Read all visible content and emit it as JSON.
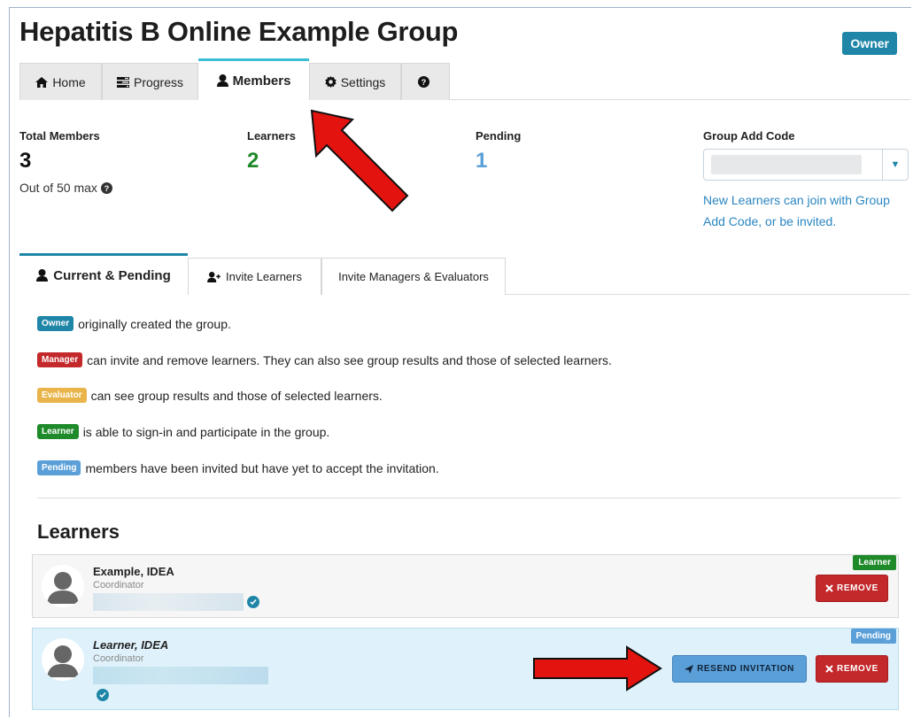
{
  "header": {
    "title": "Hepatitis B Online Example Group",
    "owner_badge": "Owner"
  },
  "tabs": [
    {
      "label": "Home",
      "icon": "home-icon"
    },
    {
      "label": "Progress",
      "icon": "progress-icon"
    },
    {
      "label": "Members",
      "icon": "user-icon",
      "active": true
    },
    {
      "label": "Settings",
      "icon": "gear-icon"
    },
    {
      "label": "",
      "icon": "help-icon"
    }
  ],
  "stats": {
    "total": {
      "label": "Total Members",
      "value": "3",
      "sub": "Out of 50 max"
    },
    "learners": {
      "label": "Learners",
      "value": "2"
    },
    "pending": {
      "label": "Pending",
      "value": "1"
    },
    "add_code": {
      "label": "Group Add Code",
      "hint": "New Learners can join with Group Add Code, or be invited."
    }
  },
  "subtabs": [
    {
      "label": "Current & Pending",
      "active": true
    },
    {
      "label": "Invite Learners"
    },
    {
      "label": "Invite Managers & Evaluators"
    }
  ],
  "roles": [
    {
      "badge": "Owner",
      "text": "originally created the group."
    },
    {
      "badge": "Manager",
      "text": "can invite and remove learners. They can also see group results and those of selected learners."
    },
    {
      "badge": "Evaluator",
      "text": "can see group results and those of selected learners."
    },
    {
      "badge": "Learner",
      "text": "is able to sign-in and participate in the group."
    },
    {
      "badge": "Pending",
      "text": "members have been invited but have yet to accept the invitation."
    }
  ],
  "learners_section": {
    "heading": "Learners",
    "items": [
      {
        "name": "Example, IDEA",
        "role": "Coordinator",
        "status": "Learner",
        "remove_label": "REMOVE"
      },
      {
        "name": "Learner, IDEA",
        "role": "Coordinator",
        "status": "Pending",
        "resend_label": "RESEND INVITATION",
        "remove_label": "REMOVE"
      }
    ]
  },
  "colors": {
    "owner": "#1f86a8",
    "manager": "#c3282b",
    "evaluator": "#e9b54a",
    "learner": "#1f8a2a",
    "pending": "#5a9fd8",
    "active_tab": "#3bbfd6",
    "arrow": "#e3130f"
  }
}
